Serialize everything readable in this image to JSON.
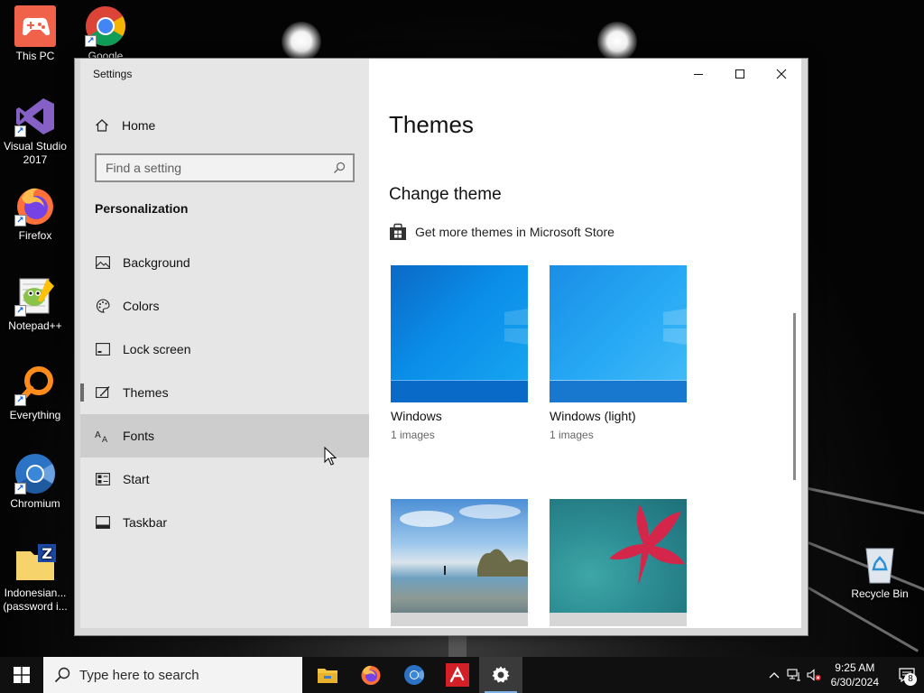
{
  "desktop": {
    "icons": [
      {
        "label": "This PC"
      },
      {
        "label": "Google Chrome"
      },
      {
        "label": "Visual Studio 2017"
      },
      {
        "label": "Firefox"
      },
      {
        "label": "Notepad++"
      },
      {
        "label": "Everything"
      },
      {
        "label": "Chromium"
      },
      {
        "label": "Indonesian... (password i..."
      },
      {
        "label": "Recycle Bin"
      }
    ]
  },
  "window": {
    "title": "Settings",
    "caption": {
      "minimize": "minimize",
      "maximize": "maximize",
      "close": "close"
    }
  },
  "sidebar": {
    "home_label": "Home",
    "search_placeholder": "Find a setting",
    "section_title": "Personalization",
    "items": [
      {
        "label": "Background",
        "icon": "picture-icon"
      },
      {
        "label": "Colors",
        "icon": "palette-icon"
      },
      {
        "label": "Lock screen",
        "icon": "lock-screen-icon"
      },
      {
        "label": "Themes",
        "icon": "brush-icon",
        "selected": true
      },
      {
        "label": "Fonts",
        "icon": "fonts-icon",
        "hovered": true
      },
      {
        "label": "Start",
        "icon": "start-icon"
      },
      {
        "label": "Taskbar",
        "icon": "taskbar-icon"
      }
    ]
  },
  "main": {
    "page_title": "Themes",
    "change_theme_title": "Change theme",
    "store_link": "Get more themes in Microsoft Store",
    "themes": [
      {
        "name": "Windows",
        "count": "1 images"
      },
      {
        "name": "Windows (light)",
        "count": "1 images"
      },
      {
        "name": "",
        "count": ""
      },
      {
        "name": "",
        "count": ""
      }
    ]
  },
  "taskbar": {
    "search_placeholder": "Type here to search",
    "apps": [
      "file-explorer-icon",
      "firefox-icon",
      "chromium-icon",
      "avira-icon",
      "settings-icon"
    ],
    "clock_time": "9:25 AM",
    "clock_date": "6/30/2024",
    "notification_count": "8"
  },
  "colors": {
    "accent": "#0078d7",
    "sidebar_bg": "#e6e6e6",
    "hover_bg": "#cdcdcd",
    "taskbar_bg": "#101010"
  }
}
